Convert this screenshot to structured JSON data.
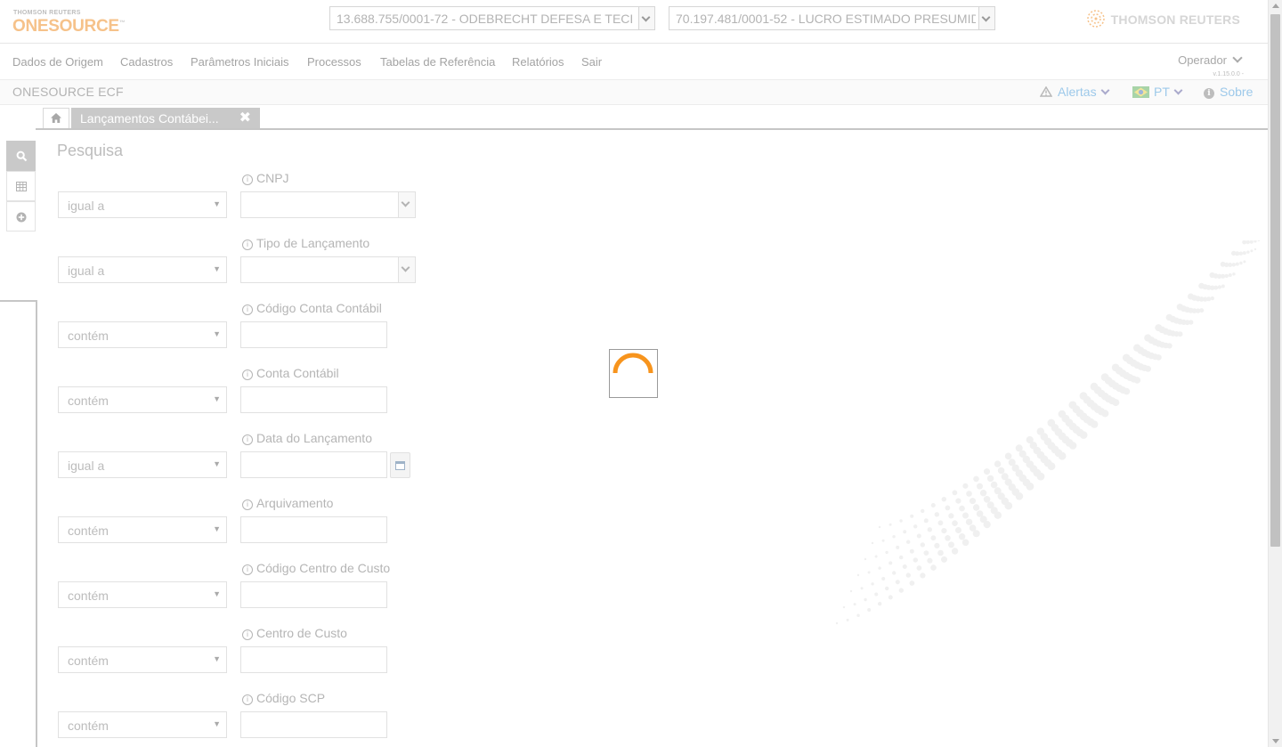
{
  "header": {
    "brand_small": "THOMSON REUTERS",
    "brand_name": "ONESOURCE",
    "brand_tm": "™",
    "company_select_1": "13.688.755/0001-72 - ODEBRECHT DEFESA E TECI",
    "company_select_2": "70.197.481/0001-52 - LUCRO ESTIMADO PRESUMID",
    "tr_logo": "THOMSON REUTERS"
  },
  "menu": {
    "items": [
      "Dados de Origem",
      "Cadastros",
      "Parâmetros Iniciais",
      "Processos",
      "Tabelas de Referência",
      "Relatórios",
      "Sair"
    ],
    "operator": "Operador",
    "version": "v.1.15.0.0 -"
  },
  "appbar": {
    "title": "ONESOURCE ECF",
    "alerts": "Alertas",
    "language": "PT",
    "about": "Sobre"
  },
  "tabs": {
    "active_label": "Lançamentos Contábei...",
    "close_glyph": "✖"
  },
  "search": {
    "title": "Pesquisa",
    "fields": [
      {
        "label": "CNPJ",
        "operator": "igual a",
        "kind": "select"
      },
      {
        "label": "Tipo de Lançamento",
        "operator": "igual a",
        "kind": "select"
      },
      {
        "label": "Código Conta Contábil",
        "operator": "contém",
        "kind": "input"
      },
      {
        "label": "Conta Contábil",
        "operator": "contém",
        "kind": "input"
      },
      {
        "label": "Data do Lançamento",
        "operator": "igual a",
        "kind": "date"
      },
      {
        "label": "Arquivamento",
        "operator": "contém",
        "kind": "input"
      },
      {
        "label": "Código Centro de Custo",
        "operator": "contém",
        "kind": "input"
      },
      {
        "label": "Centro de Custo",
        "operator": "contém",
        "kind": "input"
      },
      {
        "label": "Código SCP",
        "operator": "contém",
        "kind": "input"
      }
    ]
  },
  "colors": {
    "accent_orange": "#f7941d",
    "link_blue": "#9dc9ea"
  },
  "icons": {
    "home": "home-icon",
    "search": "search-icon",
    "calendar": "calendar-icon",
    "add": "plus-circle-icon",
    "warning": "warning-icon",
    "flag": "brazil-flag-icon",
    "info": "info-icon"
  }
}
